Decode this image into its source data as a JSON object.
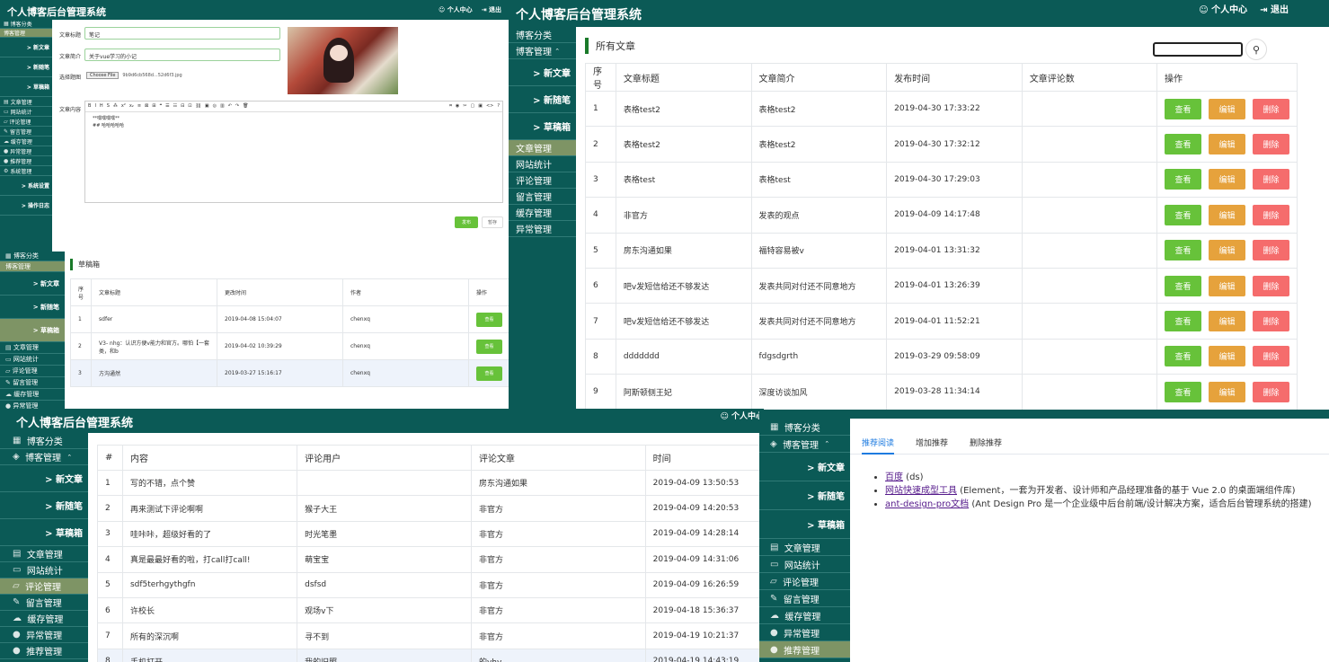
{
  "app_title": "个人博客后台管理系统",
  "header_links": {
    "profile": "个人中心",
    "logout": "退出"
  },
  "nav": {
    "blog_category": "博客分类",
    "blog_manage": "博客管理",
    "new_article": "> 新文章",
    "new_note": "> 新随笔",
    "drafts": "> 草稿箱",
    "article_manage": "文章管理",
    "site_stats": "网站统计",
    "comment_manage": "评论管理",
    "message_manage": "留言管理",
    "cache_manage": "缓存管理",
    "exception_manage": "异常管理",
    "recommend_manage": "推荐管理",
    "system_manage": "系统管理",
    "system_settings": "> 系统设置",
    "operation_log": "> 操作日志"
  },
  "editor": {
    "label_title": "文章标题",
    "title_value": "笔记",
    "label_summary": "文章简介",
    "summary_value": "关于vue学习的小记",
    "label_cover": "选择题图",
    "choose_file": "Choose File",
    "file_name": "9b9d6cb568d...52d6f3.jpg",
    "label_content": "文章内容",
    "content_line1": "**嘿嘿嘿嘿**",
    "content_line2": "## 哈哈哈哈哈",
    "toolbar_left": [
      "B",
      "I",
      "H",
      "S",
      "⁂",
      "x²",
      "x₂",
      "≡",
      "⊠",
      "⊞",
      "❝",
      "☰",
      "☷",
      "⊟",
      "⊡",
      "⛓",
      "▣",
      "◎",
      "▥",
      "↶",
      "↷",
      "🗑"
    ],
    "toolbar_right": [
      "⌗",
      "◉",
      "✂",
      "▢",
      "▣",
      "<>",
      "?"
    ],
    "publish": "发布",
    "save_draft": "暂存"
  },
  "drafts": {
    "heading": "草稿箱",
    "columns": [
      "序号",
      "文章标题",
      "更改时间",
      "作者",
      "操作"
    ],
    "rows": [
      {
        "no": "1",
        "title": "sdfer",
        "time": "2019-04-08 15:04:07",
        "author": "chenxq"
      },
      {
        "no": "2",
        "title": "V3- nhg：认识方便v能力和官方。哪怕【一套类，和b",
        "time": "2019-04-02 10:39:29",
        "author": "chenxq"
      },
      {
        "no": "3",
        "title": "方沟通然",
        "time": "2019-03-27 15:16:17",
        "author": "chenxq"
      }
    ],
    "btn_view": "查看",
    "btn_edit": "编辑",
    "btn_delete": "删除"
  },
  "articles": {
    "heading": "所有文章",
    "search_value": "",
    "columns": [
      "序号",
      "文章标题",
      "文章简介",
      "发布时间",
      "文章评论数",
      "操作"
    ],
    "rows": [
      {
        "no": "1",
        "title": "表格test2",
        "summary": "表格test2",
        "time": "2019-04-30 17:33:22",
        "comments": ""
      },
      {
        "no": "2",
        "title": "表格test2",
        "summary": "表格test2",
        "time": "2019-04-30 17:32:12",
        "comments": ""
      },
      {
        "no": "3",
        "title": "表格test",
        "summary": "表格test",
        "time": "2019-04-30 17:29:03",
        "comments": ""
      },
      {
        "no": "4",
        "title": "非官方",
        "summary": "发表的观点",
        "time": "2019-04-09 14:17:48",
        "comments": ""
      },
      {
        "no": "5",
        "title": "房东沟通如果",
        "summary": "福特容易被v",
        "time": "2019-04-01 13:31:32",
        "comments": ""
      },
      {
        "no": "6",
        "title": "吧v发短信给还不够发达",
        "summary": "发表共同对付还不同意地方",
        "time": "2019-04-01 13:26:39",
        "comments": ""
      },
      {
        "no": "7",
        "title": "吧v发短信给还不够发达",
        "summary": "发表共同对付还不同意地方",
        "time": "2019-04-01 11:52:21",
        "comments": ""
      },
      {
        "no": "8",
        "title": "ddddddd",
        "summary": "fdgsdgrth",
        "time": "2019-03-29 09:58:09",
        "comments": ""
      },
      {
        "no": "9",
        "title": "阿斯顿侧王妃",
        "summary": "深度访谈加风",
        "time": "2019-03-28 11:34:14",
        "comments": ""
      }
    ],
    "btn_view": "查看",
    "btn_edit": "编辑",
    "btn_delete": "删除"
  },
  "comments": {
    "columns": [
      "#",
      "内容",
      "评论用户",
      "评论文章",
      "时间"
    ],
    "rows": [
      {
        "no": "1",
        "content": "写的不错，点个赞",
        "user": "",
        "article": "房东沟通如果",
        "time": "2019-04-09 13:50:53"
      },
      {
        "no": "2",
        "content": "再来测试下评论啊啊",
        "user": "猴子大王",
        "article": "非官方",
        "time": "2019-04-09 14:20:53"
      },
      {
        "no": "3",
        "content": "哇咔咔，超级好看的了",
        "user": "时光笔墨",
        "article": "非官方",
        "time": "2019-04-09 14:28:14"
      },
      {
        "no": "4",
        "content": "真是最最好看的啦，打call打call!",
        "user": "萌宝宝",
        "article": "非官方",
        "time": "2019-04-09 14:31:06"
      },
      {
        "no": "5",
        "content": "sdf5terhgythgfn",
        "user": "dsfsd",
        "article": "非官方",
        "time": "2019-04-09 16:26:59"
      },
      {
        "no": "6",
        "content": "许校长",
        "user": "观场v下",
        "article": "非官方",
        "time": "2019-04-18 15:36:37"
      },
      {
        "no": "7",
        "content": "所有的深沉啊",
        "user": "寻不到",
        "article": "非官方",
        "time": "2019-04-19 10:21:37"
      },
      {
        "no": "8",
        "content": "手机打开",
        "user": "我的旧照",
        "article": "的vhv",
        "time": "2019-04-19 14:43:19"
      }
    ]
  },
  "recommend": {
    "tabs": [
      "推荐阅读",
      "增加推荐",
      "删除推荐"
    ],
    "items": [
      {
        "link": "百度",
        "desc": " (ds)"
      },
      {
        "link": "网站快速成型工具",
        "desc": " (Element，一套为开发者、设计师和产品经理准备的基于 Vue 2.0 的桌面端组件库)"
      },
      {
        "link": "ant-design-pro文档",
        "desc": " (Ant Design Pro 是一个企业级中后台前端/设计解决方案，适合后台管理系统的搭建)"
      }
    ]
  },
  "colors": {
    "header": "#0b5a56",
    "active": "#7e9465",
    "view": "#67c23a",
    "edit": "#e6a23c",
    "delete": "#f56c6c",
    "tab": "#1e7be0"
  }
}
